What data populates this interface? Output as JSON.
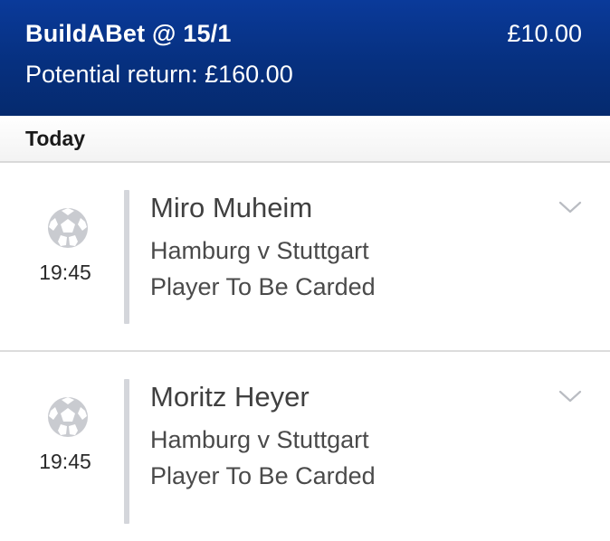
{
  "header": {
    "title": "BuildABet @ 15/1",
    "stake": "£10.00",
    "potential_return": "Potential return: £160.00"
  },
  "section": {
    "label": "Today"
  },
  "legs": [
    {
      "time": "19:45",
      "player": "Miro Muheim",
      "match": "Hamburg v Stuttgart",
      "market": "Player To Be Carded",
      "icon": "football-icon"
    },
    {
      "time": "19:45",
      "player": "Moritz Heyer",
      "match": "Hamburg v Stuttgart",
      "market": "Player To Be Carded",
      "icon": "football-icon"
    }
  ],
  "colors": {
    "header_bg": "#06307f",
    "header_text": "#ffffff",
    "divider": "#d4d6db"
  }
}
